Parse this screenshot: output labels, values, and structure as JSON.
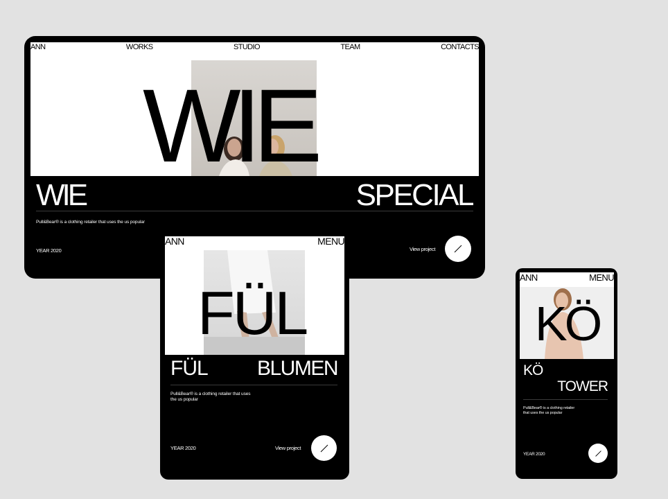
{
  "desktop": {
    "nav": [
      "ANN",
      "WORKS",
      "STUDIO",
      "TEAM",
      "CONTACTS"
    ],
    "hero_word": "WIE",
    "title_left": "WIE",
    "title_right": "SPECIAL",
    "description": "Pull&Bear® is a clothing retailer that uses the us popular",
    "year": "YEAR 2020",
    "view_label": "View project",
    "arrow_icon": "arrow-icon"
  },
  "tablet": {
    "nav_left": "ANN",
    "nav_right": "MENU",
    "hero_word": "FÜL",
    "title_left": "FÜL",
    "title_right": "BLUMEN",
    "description": "Pull&Bear® is a clothing retailer that uses the us popular",
    "year": "YEAR 2020",
    "view_label": "View project",
    "arrow_icon": "arrow-icon"
  },
  "mobile": {
    "nav_left": "ANN",
    "nav_right": "MENU",
    "hero_word": "KÖ",
    "title_line1": "KÖ",
    "title_line2": "TOWER",
    "description": "Pull&Bear® is a clothing retailer that uses the us popular",
    "year": "YEAR 2020",
    "arrow_icon": "arrow-icon"
  },
  "colors": {
    "background": "#e2e2e2",
    "device": "#000000",
    "screen": "#ffffff"
  }
}
